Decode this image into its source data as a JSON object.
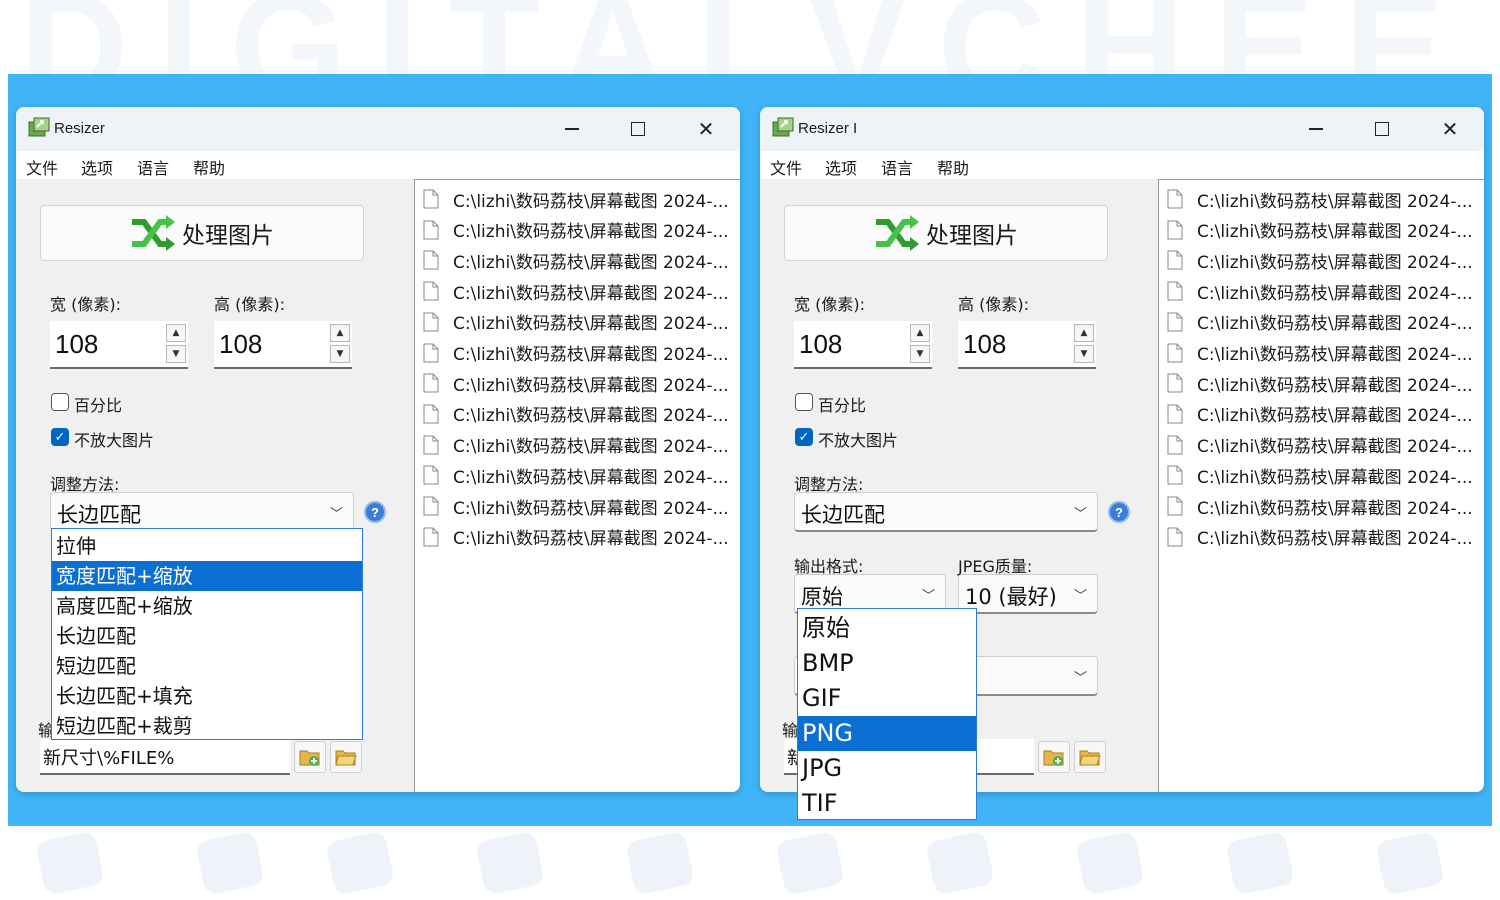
{
  "left_window": {
    "title": "Resizer",
    "menu": [
      "文件",
      "选项",
      "语言",
      "帮助"
    ],
    "process_button": "处理图片",
    "width_label": "宽 (像素):",
    "width_value": "108",
    "height_label": "高 (像素):",
    "height_value": "108",
    "percent_label": "百分比",
    "percent_checked": false,
    "no_enlarge_label": "不放大图片",
    "no_enlarge_checked": true,
    "method_label": "调整方法:",
    "method_value": "长边匹配",
    "method_options": [
      "拉伸",
      "宽度匹配+缩放",
      "高度匹配+缩放",
      "长边匹配",
      "短边匹配",
      "长边匹配+填充",
      "短边匹配+裁剪"
    ],
    "method_selected": "宽度匹配+缩放",
    "output_label_partial": "输",
    "output_path": "新尺寸\\%FILE%",
    "files": [
      "C:\\lizhi\\数码荔枝\\屏幕截图 2024-...",
      "C:\\lizhi\\数码荔枝\\屏幕截图 2024-...",
      "C:\\lizhi\\数码荔枝\\屏幕截图 2024-...",
      "C:\\lizhi\\数码荔枝\\屏幕截图 2024-...",
      "C:\\lizhi\\数码荔枝\\屏幕截图 2024-...",
      "C:\\lizhi\\数码荔枝\\屏幕截图 2024-...",
      "C:\\lizhi\\数码荔枝\\屏幕截图 2024-...",
      "C:\\lizhi\\数码荔枝\\屏幕截图 2024-...",
      "C:\\lizhi\\数码荔枝\\屏幕截图 2024-...",
      "C:\\lizhi\\数码荔枝\\屏幕截图 2024-...",
      "C:\\lizhi\\数码荔枝\\屏幕截图 2024-...",
      "C:\\lizhi\\数码荔枝\\屏幕截图 2024-..."
    ]
  },
  "right_window": {
    "title": "Resizer I",
    "menu": [
      "文件",
      "选项",
      "语言",
      "帮助"
    ],
    "process_button": "处理图片",
    "width_label": "宽 (像素):",
    "width_value": "108",
    "height_label": "高 (像素):",
    "height_value": "108",
    "percent_label": "百分比",
    "percent_checked": false,
    "no_enlarge_label": "不放大图片",
    "no_enlarge_checked": true,
    "method_label": "调整方法:",
    "method_value": "长边匹配",
    "format_label": "输出格式:",
    "format_value": "原始",
    "jpeg_label": "JPEG质量:",
    "jpeg_value": "10 (最好)",
    "format_options": [
      "原始",
      "BMP",
      "GIF",
      "PNG",
      "JPG",
      "TIF"
    ],
    "format_selected": "PNG",
    "output_label_partial": "输",
    "output_path_partial": "新",
    "files": [
      "C:\\lizhi\\数码荔枝\\屏幕截图 2024-...",
      "C:\\lizhi\\数码荔枝\\屏幕截图 2024-...",
      "C:\\lizhi\\数码荔枝\\屏幕截图 2024-...",
      "C:\\lizhi\\数码荔枝\\屏幕截图 2024-...",
      "C:\\lizhi\\数码荔枝\\屏幕截图 2024-...",
      "C:\\lizhi\\数码荔枝\\屏幕截图 2024-...",
      "C:\\lizhi\\数码荔枝\\屏幕截图 2024-...",
      "C:\\lizhi\\数码荔枝\\屏幕截图 2024-...",
      "C:\\lizhi\\数码荔枝\\屏幕截图 2024-...",
      "C:\\lizhi\\数码荔枝\\屏幕截图 2024-...",
      "C:\\lizhi\\数码荔枝\\屏幕截图 2024-...",
      "C:\\lizhi\\数码荔枝\\屏幕截图 2024-..."
    ]
  },
  "background_watermark": "DIGITALVCHEE",
  "colors": {
    "stage": "#3fb5f7",
    "selection": "#0b6fd3",
    "checkbox_on": "#0067c0"
  },
  "icons": {
    "app": "resizer-app-icon",
    "process": "shuffle-arrows-icon",
    "file": "file-icon",
    "add_folder": "add-folder-icon",
    "open_folder": "open-folder-icon",
    "help": "help-icon"
  }
}
